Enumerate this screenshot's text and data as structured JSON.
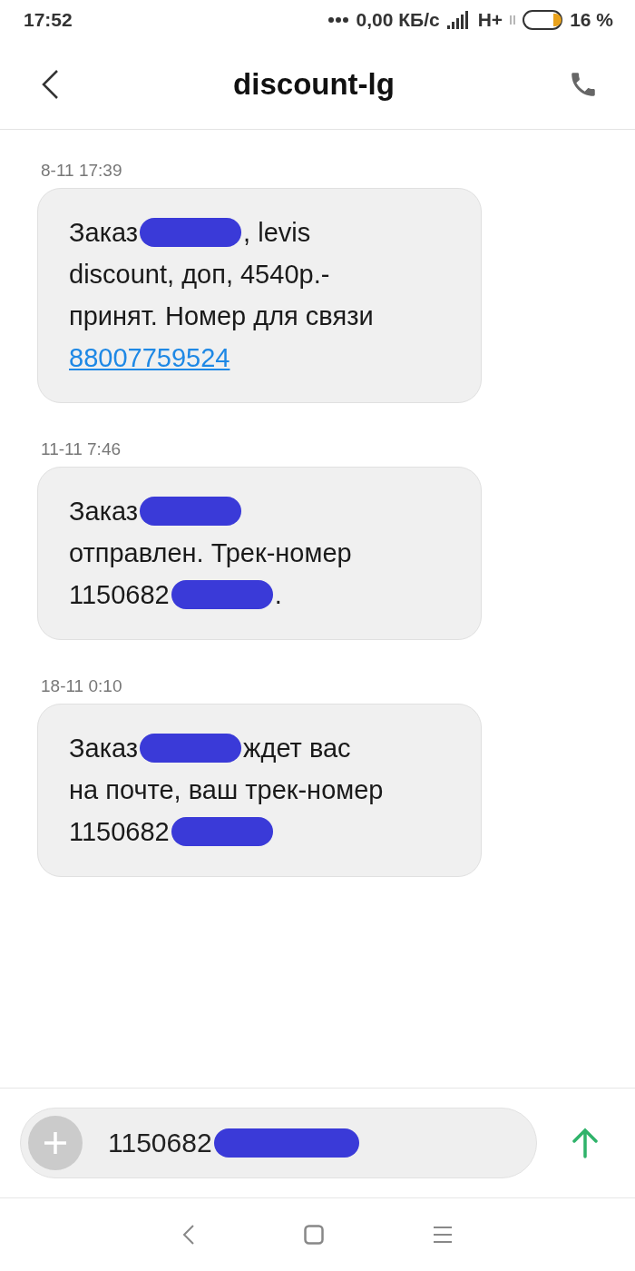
{
  "status_bar": {
    "time": "17:52",
    "speed": "0,00 КБ/с",
    "network": "H+",
    "battery": "16 %"
  },
  "header": {
    "title": "discount-lg"
  },
  "messages": [
    {
      "time": "8-11 17:39",
      "lines": [
        [
          {
            "kind": "text",
            "text": "Заказ"
          },
          {
            "kind": "redaction"
          },
          {
            "kind": "text",
            "text": ", levis"
          }
        ],
        [
          {
            "kind": "text",
            "text": "discount, доп, 4540р.-"
          }
        ],
        [
          {
            "kind": "text",
            "text": "принят. Номер для связи"
          }
        ],
        [
          {
            "kind": "link",
            "text": "88007759524"
          }
        ]
      ]
    },
    {
      "time": "11-11 7:46",
      "lines": [
        [
          {
            "kind": "text",
            "text": "Заказ"
          },
          {
            "kind": "redaction"
          }
        ],
        [
          {
            "kind": "text",
            "text": "отправлен. Трек-номер"
          }
        ],
        [
          {
            "kind": "text",
            "text": "1150682"
          },
          {
            "kind": "redaction"
          },
          {
            "kind": "text",
            "text": "."
          }
        ]
      ]
    },
    {
      "time": "18-11 0:10",
      "lines": [
        [
          {
            "kind": "text",
            "text": "Заказ"
          },
          {
            "kind": "redaction"
          },
          {
            "kind": "text",
            "text": "ждет вас"
          }
        ],
        [
          {
            "kind": "text",
            "text": "на почте, ваш трек-номер"
          }
        ],
        [
          {
            "kind": "text",
            "text": "1150682"
          },
          {
            "kind": "redaction"
          }
        ]
      ]
    }
  ],
  "compose": {
    "value": "1150682",
    "redacted": true
  }
}
